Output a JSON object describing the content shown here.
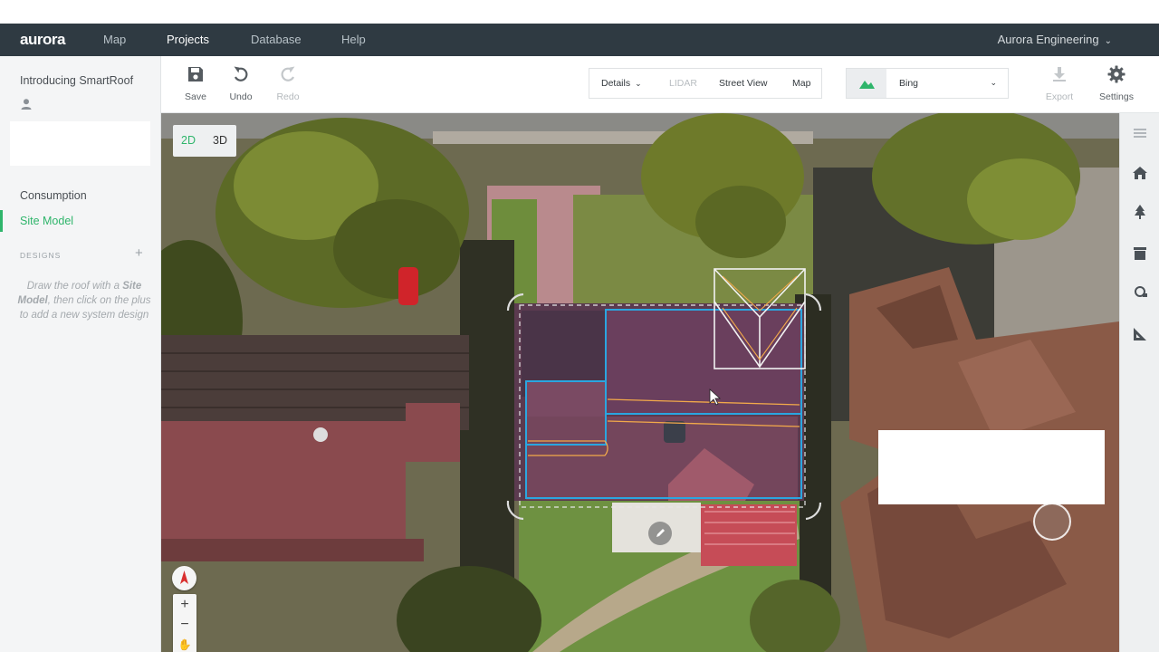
{
  "app": {
    "logo": "aurora",
    "nav": [
      {
        "label": "Map"
      },
      {
        "label": "Projects"
      },
      {
        "label": "Database"
      },
      {
        "label": "Help"
      }
    ],
    "active_nav": "Projects",
    "account": "Aurora Engineering"
  },
  "sidebar": {
    "project_title": "Introducing SmartRoof",
    "links": [
      {
        "label": "Consumption"
      },
      {
        "label": "Site Model"
      }
    ],
    "active_link": "Site Model",
    "designs_label": "DESIGNS",
    "designs_add": "+",
    "hint_pre": "Draw the roof with a ",
    "hint_bold": "Site Model",
    "hint_post": ", then click on the plus to add a new system design"
  },
  "toolbar": {
    "save": "Save",
    "undo": "Undo",
    "redo": "Redo",
    "view_modes": [
      {
        "label": "Details"
      },
      {
        "label": "LIDAR"
      },
      {
        "label": "Street View"
      },
      {
        "label": "Map"
      }
    ],
    "imagery_provider": "Bing",
    "export": "Export",
    "settings": "Settings"
  },
  "map_controls": {
    "dim_2d": "2D",
    "dim_3d": "3D",
    "active_dim": "2D",
    "zoom_in": "+",
    "zoom_out": "−"
  },
  "right_rail": {
    "icons": [
      "menu-icon",
      "home-icon",
      "tree-icon",
      "trash-bin-icon",
      "camera-icon",
      "ruler-icon"
    ]
  },
  "colors": {
    "navbar": "#2f3a42",
    "accent": "#2fb56b",
    "roof_outline": "#2aa6e0",
    "setback_line": "#f2a94a"
  }
}
